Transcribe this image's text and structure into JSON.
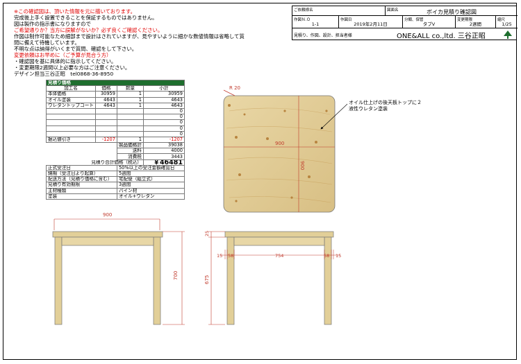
{
  "notes": [
    {
      "text": "※この確認図は、頂いた情報を元に描いております。",
      "red": true
    },
    {
      "text": "完成後上手く設置できることを保証するものではありません。",
      "red": false
    },
    {
      "text": "図は製作の指示書になりますので",
      "red": false
    },
    {
      "text": "ご希望通りか？当方に誤解がないか？必ず良くご確認ください。",
      "red": true
    },
    {
      "text": "作図は制作可能なため細部まで設計はされていますが、見やすいように細かな数値情報は省略して質",
      "red": false
    },
    {
      "text": "問に備えて待機しています。",
      "red": false
    },
    {
      "text": "不明な点は納得がいくまで質問、確認をして下さい。",
      "red": false
    },
    {
      "text": "変更依頼はお早めに（ご予算が見合う方）",
      "red": true
    },
    {
      "text": "・確認図を基に具体的に指示してください。",
      "red": false
    },
    {
      "text": "・変更期限2週間以上必要な方はご注意ください。",
      "red": false
    },
    {
      "text": "デザイン担当三谷正昭　tel0868-36-8950",
      "red": false
    }
  ],
  "title_block": {
    "customer_label": "ご依頼様名",
    "drawing_name_label": "図面名",
    "drawing_name": "ボイカ見積り確認図",
    "drawing_no_label": "作図Ｎ.Ｏ",
    "drawing_no": "1-1",
    "date_label": "作図日",
    "date": "2019年2月11日",
    "category_label": "分類、保管",
    "category": "タブV",
    "change_label": "変更期限",
    "change": "2週間",
    "scale_label": "縮尺",
    "scale": "1/25",
    "footer": "見積り、作図、設計、担当者様",
    "company": "ONE&ALL co.,ltd. 三谷正昭"
  },
  "estimate": {
    "title": "見積り価格",
    "headers": [
      "加工名",
      "価格",
      "数量",
      "小計"
    ],
    "rows": [
      {
        "name": "本体価格",
        "price": "30959",
        "qty": "1",
        "subtotal": "30959",
        "neg": false
      },
      {
        "name": "オイル塗装",
        "price": "4643",
        "qty": "1",
        "subtotal": "4643",
        "neg": false
      },
      {
        "name": "ウレタントップコート",
        "price": "4643",
        "qty": "1",
        "subtotal": "4643",
        "neg": false
      },
      {
        "name": "",
        "price": "",
        "qty": "",
        "subtotal": "0",
        "neg": false
      },
      {
        "name": "",
        "price": "",
        "qty": "",
        "subtotal": "0",
        "neg": false
      },
      {
        "name": "",
        "price": "",
        "qty": "",
        "subtotal": "0",
        "neg": false
      },
      {
        "name": "",
        "price": "",
        "qty": "",
        "subtotal": "0",
        "neg": false
      },
      {
        "name": "",
        "price": "",
        "qty": "",
        "subtotal": "0",
        "neg": false
      },
      {
        "name": "据込値引き",
        "price": "-1207",
        "qty": "1",
        "subtotal": "-1207",
        "neg": true
      }
    ],
    "product_total_label": "製品価格計",
    "product_total": "39038",
    "shipping_label": "送料",
    "shipping": "4000",
    "consumption_label": "消費税",
    "consumption": "3443",
    "grand_label": "見積り合計価格（税込）",
    "grand_total": "￥46481",
    "info": [
      {
        "label": "正式受注日",
        "value": "50%以上の受注金額確認日"
      },
      {
        "label": "納期（受注日より起算）",
        "value": "5週間"
      },
      {
        "label": "配送方法（見積り価格に含む）",
        "value": "宅配便（組立式）"
      },
      {
        "label": "見積り有効期限",
        "value": "3週間"
      },
      {
        "label": "主材種類",
        "value": "パイン材"
      },
      {
        "label": "塗装",
        "value": "オイル+ウレタン"
      }
    ]
  },
  "drawing": {
    "corner_r": "R 20",
    "top_width": "900",
    "top_depth": "900",
    "note1": "オイル仕上げの後天板トップに２",
    "note2": "液性ウレタン塗装",
    "front_width": "900",
    "front_height": "700",
    "side_top": "25",
    "side_leg": "675",
    "side_dims": [
      "15",
      "58",
      "754",
      "58",
      "15"
    ]
  }
}
